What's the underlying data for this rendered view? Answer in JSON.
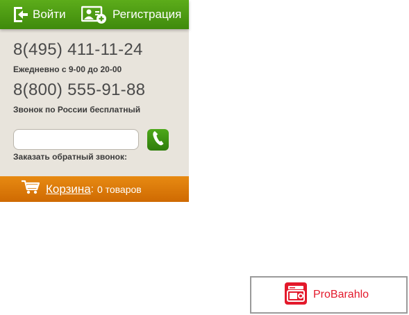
{
  "topbar": {
    "login_label": "Войти",
    "register_label": "Регистрация"
  },
  "contacts": {
    "phone1": "8(495) 411-11-24",
    "phone1_note": "Ежедневно с 9-00 до 20-00",
    "phone2": "8(800) 555-91-88",
    "phone2_note": "Звонок по России бесплатный"
  },
  "callback": {
    "input_value": "",
    "label": "Заказать обратный звонок:"
  },
  "cart": {
    "link_label": "Корзина",
    "separator": ":",
    "count_text": "0 товаров"
  },
  "badge": {
    "text": "ProBarahlo"
  },
  "icons": {
    "login": "door-enter-icon",
    "register": "user-add-icon",
    "call": "phone-handset-icon",
    "cart": "shopping-cart-icon",
    "badge": "probarahlo-logo-icon"
  },
  "colors": {
    "topbar_green": "#4f9e14",
    "panel_bg": "#e8e4dc",
    "cart_orange": "#dd7a08",
    "call_green": "#3f9412",
    "brand_red": "#e3192b"
  }
}
